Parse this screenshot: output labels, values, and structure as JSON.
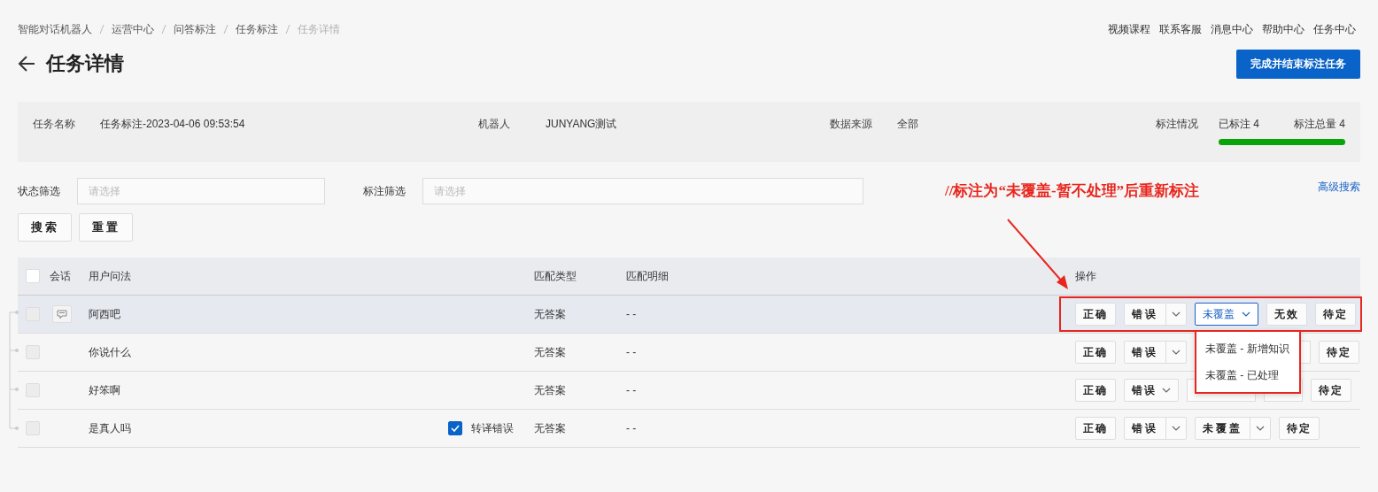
{
  "breadcrumb": [
    {
      "label": "智能对话机器人",
      "selected": false
    },
    {
      "label": "运营中心",
      "selected": false
    },
    {
      "label": "问答标注",
      "selected": false
    },
    {
      "label": "任务标注",
      "selected": false
    },
    {
      "label": "任务详情",
      "selected": true
    }
  ],
  "top_links": [
    "视频课程",
    "联系客服",
    "消息中心",
    "帮助中心",
    "任务中心"
  ],
  "title": "任务详情",
  "primary_button": "完成并结束标注任务",
  "info": {
    "fields": [
      {
        "label": "任务名称",
        "value": "任务标注-2023-04-06 09:53:54"
      },
      {
        "label": "机器人",
        "value": "JUNYANG测试"
      },
      {
        "label": "数据来源",
        "value": "全部"
      }
    ],
    "status": {
      "label": "标注情况",
      "done": "已标注 4",
      "total": "标注总量 4",
      "level": 1
    }
  },
  "filters": [
    {
      "label": "状态筛选",
      "placeholder": "请选择"
    },
    {
      "label": "标注筛选",
      "placeholder": "请选择"
    }
  ],
  "advanced_link": "高级搜索",
  "buttons": [
    "搜索",
    "重置"
  ],
  "note": "//标注为“未覆盖-暂不处理”后重新标注",
  "table": {
    "header_checkbox": {
      "disabled": false
    },
    "columns": [
      "会话",
      "用户问法",
      "匹配类型",
      "匹配明细",
      "操作"
    ],
    "rows": [
      {
        "disabled": true,
        "hovered": true,
        "has_chat": true,
        "question": "阿西吧",
        "match_type": "无答案",
        "match_detail": "- -",
        "highlighted": true,
        "actions": [
          {
            "kind": "button",
            "label": "正确"
          },
          {
            "kind": "split",
            "label": "错误"
          },
          {
            "kind": "open",
            "label": "未覆盖"
          },
          {
            "kind": "button",
            "label": "无效"
          },
          {
            "kind": "button",
            "label": "待定"
          }
        ]
      },
      {
        "disabled": true,
        "hovered": false,
        "has_chat": false,
        "question": "你说什么",
        "match_type": "无答案",
        "match_detail": "- -",
        "highlighted": false,
        "actions": [
          {
            "kind": "button",
            "label": "正确"
          },
          {
            "kind": "split",
            "label": "错误"
          },
          {
            "kind": "covered-gap"
          },
          {
            "kind": "button",
            "label": "待定"
          }
        ]
      },
      {
        "disabled": true,
        "hovered": false,
        "has_chat": false,
        "question": "好笨啊",
        "match_type": "无答案",
        "match_detail": "- -",
        "highlighted": false,
        "actions": [
          {
            "kind": "button",
            "label": "正确"
          },
          {
            "kind": "dropdown",
            "label": "错误"
          },
          {
            "kind": "covered-split"
          },
          {
            "kind": "covered"
          },
          {
            "kind": "button",
            "label": "待定"
          }
        ]
      },
      {
        "disabled": true,
        "hovered": false,
        "has_chat": false,
        "question": "是真人吗",
        "tag": {
          "label": "转译错误",
          "checked": true
        },
        "match_type": "无答案",
        "match_detail": "- -",
        "highlighted": false,
        "actions": [
          {
            "kind": "button",
            "label": "正确"
          },
          {
            "kind": "split",
            "label": "错误"
          },
          {
            "kind": "split",
            "label": "未覆盖"
          },
          {
            "kind": "button",
            "label": "待定"
          }
        ]
      }
    ]
  },
  "dropdown": {
    "highlighted": true,
    "options": [
      "未覆盖 - 新增知识",
      "未覆盖 - 已处理"
    ]
  }
}
